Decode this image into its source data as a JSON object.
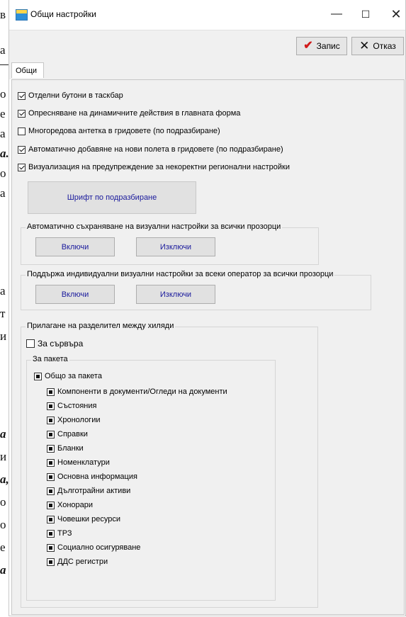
{
  "background_text": [
    "в",
    "а",
    "о",
    "е",
    "а",
    "а.",
    "о",
    "а",
    "а",
    "т",
    "и",
    "а",
    "и",
    "а,",
    "о",
    "о",
    "е",
    "а"
  ],
  "window": {
    "title": "Общи настройки",
    "minimize": "—",
    "maximize": "☐",
    "close": "✕"
  },
  "toolbar": {
    "save_label": "Запис",
    "cancel_label": "Отказ"
  },
  "tabs": [
    {
      "label": "Общи"
    }
  ],
  "options": [
    {
      "label": "Отделни бутони в таскбар",
      "checked": true
    },
    {
      "label": "Опресняване на динамичните действия в главната форма",
      "checked": true
    },
    {
      "label": "Многоредова антетка в гридовете (по подразбиране)",
      "checked": false
    },
    {
      "label": "Автоматично добавяне на нови полета в гридовете (по подразбиране)",
      "checked": true
    },
    {
      "label": "Визуализация на предупреждение за некоректни регионални настройки",
      "checked": true
    }
  ],
  "font_button": "Шрифт по подразбиране",
  "autosave_group": {
    "title": "Автоматично съхраняване на визуални настройки за всички прозорци",
    "on": "Включи",
    "off": "Изключи"
  },
  "operator_group": {
    "title": "Поддържа индивидуални визуални настройки за всеки оператор за всички прозорци",
    "on": "Включи",
    "off": "Изключи"
  },
  "thousands_group": {
    "title": "Прилагане на разделител между хиляди",
    "server": {
      "label": "За сървъра",
      "checked": false
    },
    "package_group": {
      "title": "За пакета",
      "all": "Общо за пакета",
      "items": [
        "Компоненти в документи/Огледи на документи",
        "Състояния",
        "Хронологии",
        "Справки",
        "Бланки",
        "Номенклатури",
        "Основна информация",
        "Дълготрайни активи",
        "Хонорари",
        "Човешки ресурси",
        "ТРЗ",
        "Социално осигуряване",
        "ДДС регистри"
      ]
    }
  }
}
